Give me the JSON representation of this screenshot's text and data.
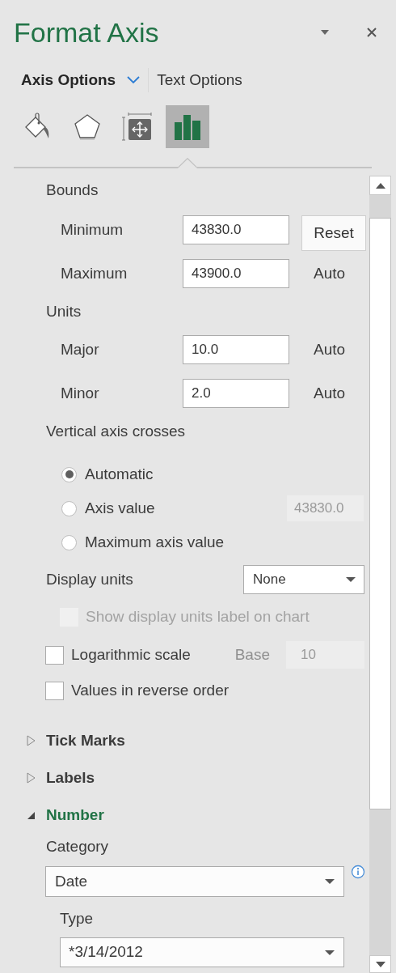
{
  "panel": {
    "title": "Format Axis"
  },
  "tabs": [
    {
      "label": "Axis Options",
      "selected": true
    },
    {
      "label": "Text Options",
      "selected": false
    }
  ],
  "icon_tabs": [
    {
      "kind": "fill",
      "selected": false
    },
    {
      "kind": "effects",
      "selected": false
    },
    {
      "kind": "size",
      "selected": false
    },
    {
      "kind": "axis",
      "selected": true
    }
  ],
  "bounds": {
    "heading": "Bounds",
    "rows": [
      {
        "label": "Minimum",
        "value": "43830.0",
        "action": {
          "kind": "button",
          "text": "Reset"
        }
      },
      {
        "label": "Maximum",
        "value": "43900.0",
        "action": {
          "kind": "text",
          "text": "Auto"
        }
      }
    ]
  },
  "units": {
    "heading": "Units",
    "rows": [
      {
        "label": "Major",
        "value": "10.0",
        "action": {
          "kind": "text",
          "text": "Auto"
        }
      },
      {
        "label": "Minor",
        "value": "2.0",
        "action": {
          "kind": "text",
          "text": "Auto"
        }
      }
    ]
  },
  "vertical_axis_crosses": {
    "heading": "Vertical axis crosses",
    "options": [
      {
        "label": "Automatic",
        "selected": true
      },
      {
        "label": "Axis value",
        "selected": false,
        "field": {
          "value": "43830.0",
          "disabled": true
        }
      },
      {
        "label": "Maximum axis value",
        "selected": false
      }
    ]
  },
  "display_units": {
    "label": "Display units",
    "value": "None"
  },
  "show_units_label": {
    "label": "Show display units label on chart",
    "checked": false,
    "disabled": true
  },
  "logarithmic_scale": {
    "label": "Logarithmic scale",
    "checked": false,
    "disabled": false,
    "base": {
      "label": "Base",
      "value": "10",
      "disabled": true
    }
  },
  "reverse_order": {
    "label": "Values in reverse order",
    "checked": false,
    "disabled": false
  },
  "sections": [
    {
      "title": "Tick Marks",
      "expanded": false
    },
    {
      "title": "Labels",
      "expanded": false
    },
    {
      "title": "Number",
      "expanded": true
    }
  ],
  "number": {
    "category": {
      "label": "Category",
      "value": "Date"
    },
    "type": {
      "label": "Type",
      "value": "*3/14/2012"
    }
  }
}
